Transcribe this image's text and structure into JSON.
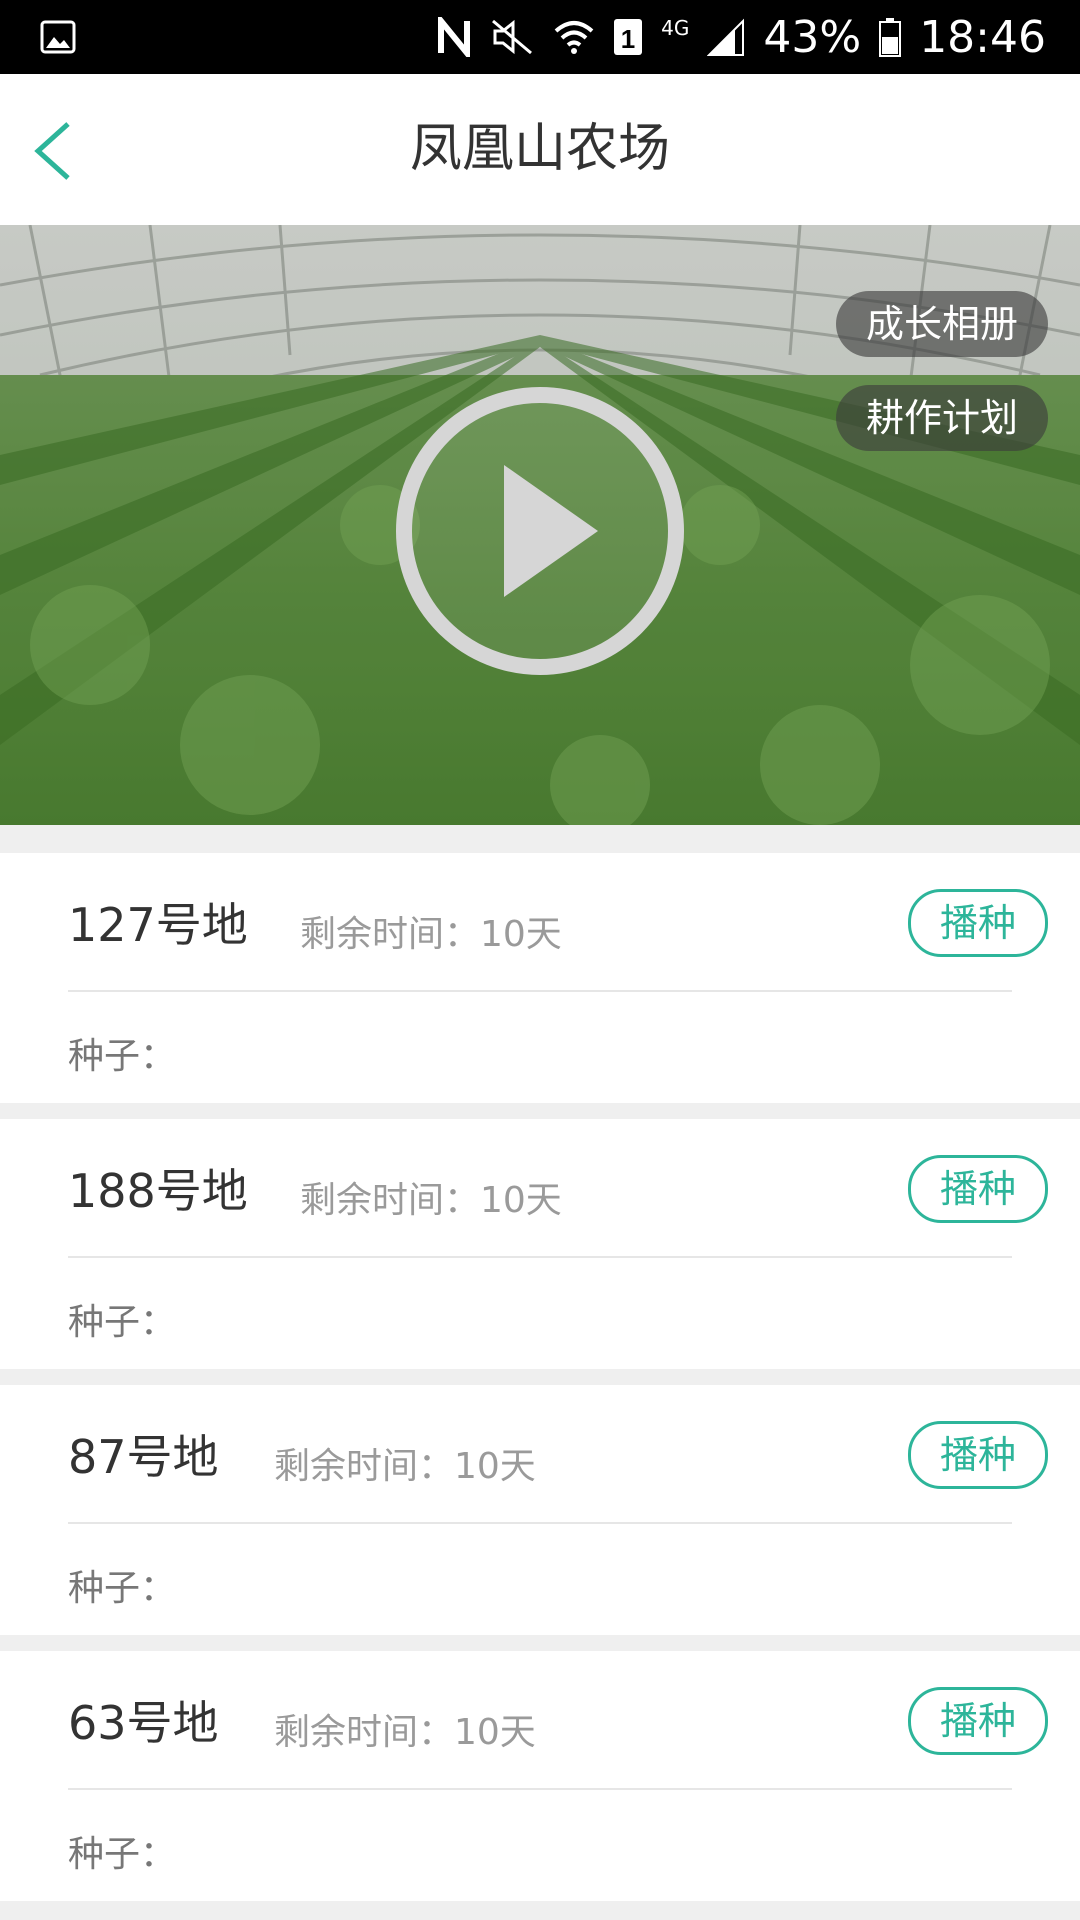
{
  "status_bar": {
    "battery": "43%",
    "time": "18:46",
    "network": "4G"
  },
  "nav": {
    "title": "凤凰山农场"
  },
  "hero": {
    "album_label": "成长相册",
    "plan_label": "耕作计划"
  },
  "plots": [
    {
      "name": "127号地",
      "remaining": "剩余时间：10天",
      "action": "播种",
      "seed_label": "种子："
    },
    {
      "name": "188号地",
      "remaining": "剩余时间：10天",
      "action": "播种",
      "seed_label": "种子："
    },
    {
      "name": "87号地",
      "remaining": "剩余时间：10天",
      "action": "播种",
      "seed_label": "种子："
    },
    {
      "name": "63号地",
      "remaining": "剩余时间：10天",
      "action": "播种",
      "seed_label": "种子："
    }
  ],
  "colors": {
    "accent": "#2db59a",
    "title_text": "#333333",
    "muted_text": "#9a9a9a"
  }
}
